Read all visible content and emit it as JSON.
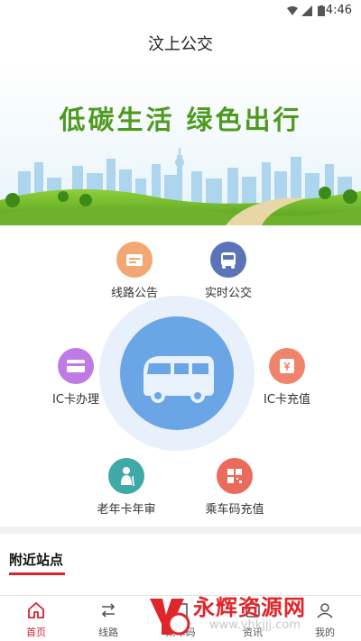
{
  "status_bar": {
    "time": "4:46"
  },
  "header": {
    "title": "汶上公交"
  },
  "banner": {
    "slogan": "低碳生活 绿色出行"
  },
  "menu": {
    "route_notice": "线路公告",
    "realtime_bus": "实时公交",
    "ic_card_apply": "IC卡办理",
    "ic_card_recharge": "IC卡充值",
    "senior_card_review": "老年卡年审",
    "ride_code_recharge": "乘车码充值"
  },
  "nearby": {
    "title": "附近站点"
  },
  "tabs": [
    {
      "label": "首页"
    },
    {
      "label": "线路"
    },
    {
      "label": "乘车码"
    },
    {
      "label": "资讯"
    },
    {
      "label": "我的"
    }
  ],
  "watermark": {
    "text": "永辉资源网",
    "url": "www.yhkjjj.com"
  },
  "colors": {
    "accent_red": "#d9232d",
    "hub_blue": "#6aa5e6",
    "route_notice": "#f3a873",
    "realtime_bus": "#5b74b8",
    "ic_card_apply": "#c07ae6",
    "ic_card_recharge": "#f0836b",
    "senior_card_review": "#3fa9a7",
    "ride_code_recharge": "#ea6b5c"
  }
}
